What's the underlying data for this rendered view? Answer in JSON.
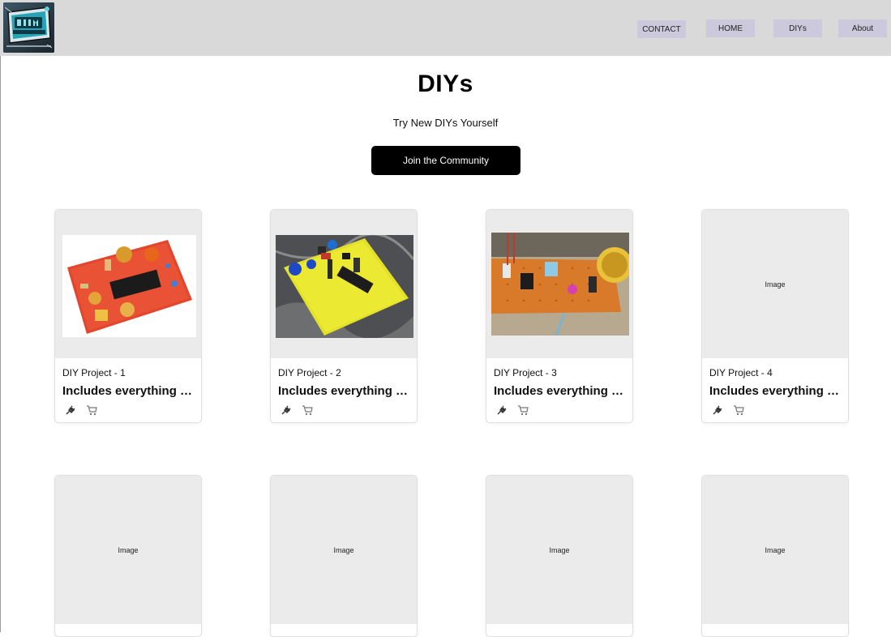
{
  "header": {
    "nav": [
      {
        "label": "CONTACT"
      },
      {
        "label": "HOME"
      },
      {
        "label": "DIYs"
      },
      {
        "label": "About"
      }
    ],
    "nav_color": "#ccc9dc",
    "bar_color": "#d9d9d9"
  },
  "hero": {
    "title": "DIYs",
    "subtitle": "Try New DIYs Yourself",
    "cta_label": "Join the Community"
  },
  "cards_row1": [
    {
      "label": "DIY Project - 1",
      "desc": "Includes everything you need",
      "image": "photo-red-pcb",
      "icons": [
        "plug-icon",
        "cart-icon"
      ]
    },
    {
      "label": "DIY Project - 2",
      "desc": "Includes everything you need",
      "image": "photo-yellow-pcb",
      "icons": [
        "plug-icon",
        "cart-icon"
      ]
    },
    {
      "label": "DIY Project - 3",
      "desc": "Includes everything you need",
      "image": "photo-perfboard",
      "icons": [
        "plug-icon",
        "cart-icon"
      ]
    },
    {
      "label": "DIY Project - 4",
      "desc": "Includes everything you need",
      "image_placeholder": "Image",
      "icons": [
        "plug-icon",
        "cart-icon"
      ]
    }
  ],
  "cards_row2": [
    {
      "image_placeholder": "Image"
    },
    {
      "image_placeholder": "Image"
    },
    {
      "image_placeholder": "Image"
    },
    {
      "image_placeholder": "Image"
    }
  ]
}
